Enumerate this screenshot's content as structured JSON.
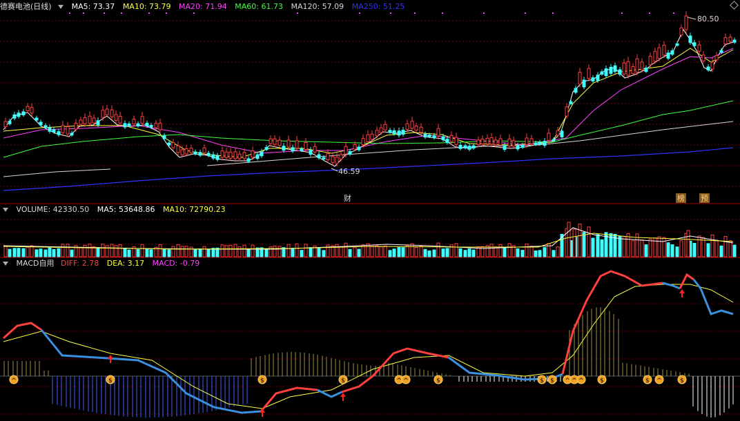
{
  "window": {
    "stock_title": "德赛电池(日线)"
  },
  "price_panel": {
    "legend": [
      {
        "label": "MA5: 73.37",
        "color": "#ffffff"
      },
      {
        "label": "MA10: 73.79",
        "color": "#ffff40"
      },
      {
        "label": "MA20: 71.94",
        "color": "#ff40ff"
      },
      {
        "label": "MA60: 61.73",
        "color": "#40ff40"
      },
      {
        "label": "MA120: 57.09",
        "color": "#d8d8d8"
      },
      {
        "label": "MA250: 51.25",
        "color": "#3030ff"
      }
    ],
    "high_label": "80.50",
    "low_label": "46.59",
    "event_marks": [
      "财",
      "榜",
      "预"
    ]
  },
  "volume_panel": {
    "legend": [
      {
        "label": "VOLUME: 42330.50",
        "color": "#d8d8d8"
      },
      {
        "label": "MA5: 53648.86",
        "color": "#ffffff"
      },
      {
        "label": "MA10: 72790.23",
        "color": "#ffff40"
      }
    ]
  },
  "macd_panel": {
    "title": "MACD自用",
    "legend": [
      {
        "label": "DIFF: 2.78",
        "color": "#ff4040"
      },
      {
        "label": "DEA: 3.17",
        "color": "#ffff40"
      },
      {
        "label": "MACD: -0.79",
        "color": "#ff40ff"
      }
    ]
  },
  "colors": {
    "up": "#ff4040",
    "down": "#40ffff",
    "grid": "#7a0000",
    "divider": "#a00000"
  },
  "chart_data": {
    "type": "candlestick",
    "indicators": [
      "MA5",
      "MA10",
      "MA20",
      "MA60",
      "MA120",
      "MA250",
      "VOLUME",
      "MACD"
    ],
    "price_axis_approx_range": [
      44,
      82
    ],
    "price_anchors": {
      "period_high": 80.5,
      "period_low": 46.59
    },
    "last_values": {
      "MA5": 73.37,
      "MA10": 73.79,
      "MA20": 71.94,
      "MA60": 61.73,
      "MA120": 57.09,
      "MA250": 51.25,
      "VOLUME": 42330.5,
      "VOL_MA5": 53648.86,
      "VOL_MA10": 72790.23,
      "DIFF": 2.78,
      "DEA": 3.17,
      "MACD": -0.79
    }
  }
}
